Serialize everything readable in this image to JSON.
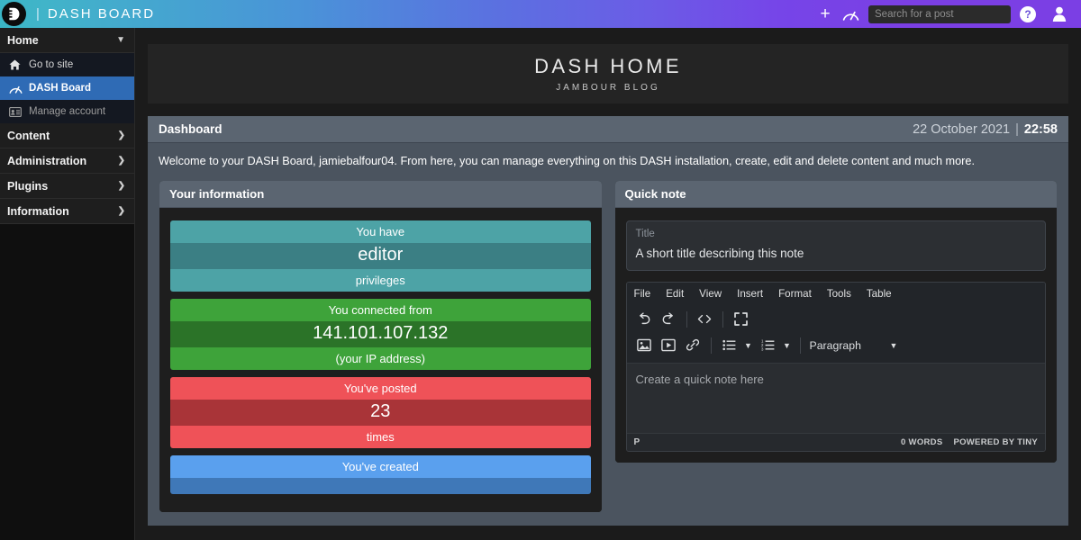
{
  "topbar": {
    "brand": "DASH BOARD",
    "divider": "|",
    "add_icon": "plus-icon",
    "dash_icon": "speedometer-icon",
    "search": {
      "value": "",
      "placeholder": "Search for a post"
    },
    "help_label": "?",
    "account_icon": "user-icon",
    "logo_icon": "dash-logo-icon"
  },
  "sidebar": {
    "groups": [
      {
        "label": "Home",
        "expanded": true,
        "items": [
          {
            "label": "Go to site",
            "icon": "home-icon",
            "active": false,
            "dim": false
          },
          {
            "label": "DASH Board",
            "icon": "speedometer-icon",
            "active": true,
            "dim": false
          },
          {
            "label": "Manage account",
            "icon": "id-card-icon",
            "active": false,
            "dim": true
          }
        ]
      },
      {
        "label": "Content",
        "expanded": false,
        "items": []
      },
      {
        "label": "Administration",
        "expanded": false,
        "items": []
      },
      {
        "label": "Plugins",
        "expanded": false,
        "items": []
      },
      {
        "label": "Information",
        "expanded": false,
        "items": []
      }
    ]
  },
  "hero": {
    "title": "DASH HOME",
    "subtitle": "JAMBOUR BLOG"
  },
  "dashbar": {
    "title": "Dashboard",
    "date": "22 October 2021",
    "separator": "|",
    "time": "22:58"
  },
  "welcome": {
    "text": "Welcome to your DASH Board, jamiebalfour04. From here, you can manage everything on this DASH installation, create, edit and delete content and much more."
  },
  "info_panel": {
    "title": "Your information",
    "cards": [
      {
        "top": "You have",
        "middle": "editor",
        "bottom": "privileges",
        "color_light": "#4da3a6",
        "color_dark": "#3b7f84"
      },
      {
        "top": "You connected from",
        "middle": "141.101.107.132",
        "bottom": "(your IP address)",
        "color_light": "#3ea33a",
        "color_dark": "#2b7328"
      },
      {
        "top": "You've posted",
        "middle": "23",
        "bottom": "times",
        "color_light": "#ef5258",
        "color_dark": "#a93438"
      },
      {
        "top": "You've created",
        "middle": "",
        "bottom": "",
        "color_light": "#5aa0ee",
        "color_dark": "#3f78b8"
      }
    ]
  },
  "quick_note": {
    "title": "Quick note",
    "title_field": {
      "label": "Title",
      "value": "A short title describing this note",
      "placeholder": "A short title describing this note"
    },
    "editor": {
      "menus": [
        "File",
        "Edit",
        "View",
        "Insert",
        "Format",
        "Tools",
        "Table"
      ],
      "toolbar_row1": [
        {
          "name": "undo-icon"
        },
        {
          "name": "redo-icon"
        },
        {
          "name": "separator"
        },
        {
          "name": "source-code-icon"
        },
        {
          "name": "separator"
        },
        {
          "name": "fullscreen-icon"
        }
      ],
      "toolbar_row2": [
        {
          "name": "insert-image-icon"
        },
        {
          "name": "insert-media-icon"
        },
        {
          "name": "insert-link-icon"
        },
        {
          "name": "separator"
        },
        {
          "name": "bullet-list-icon"
        },
        {
          "name": "chevron-down-icon"
        },
        {
          "name": "numbered-list-icon"
        },
        {
          "name": "chevron-down-icon"
        },
        {
          "name": "separator"
        }
      ],
      "format_select": "Paragraph",
      "body_placeholder": "Create a quick note here",
      "status_element": "P",
      "status_words": "0 WORDS",
      "status_branding": "POWERED BY TINY"
    }
  }
}
